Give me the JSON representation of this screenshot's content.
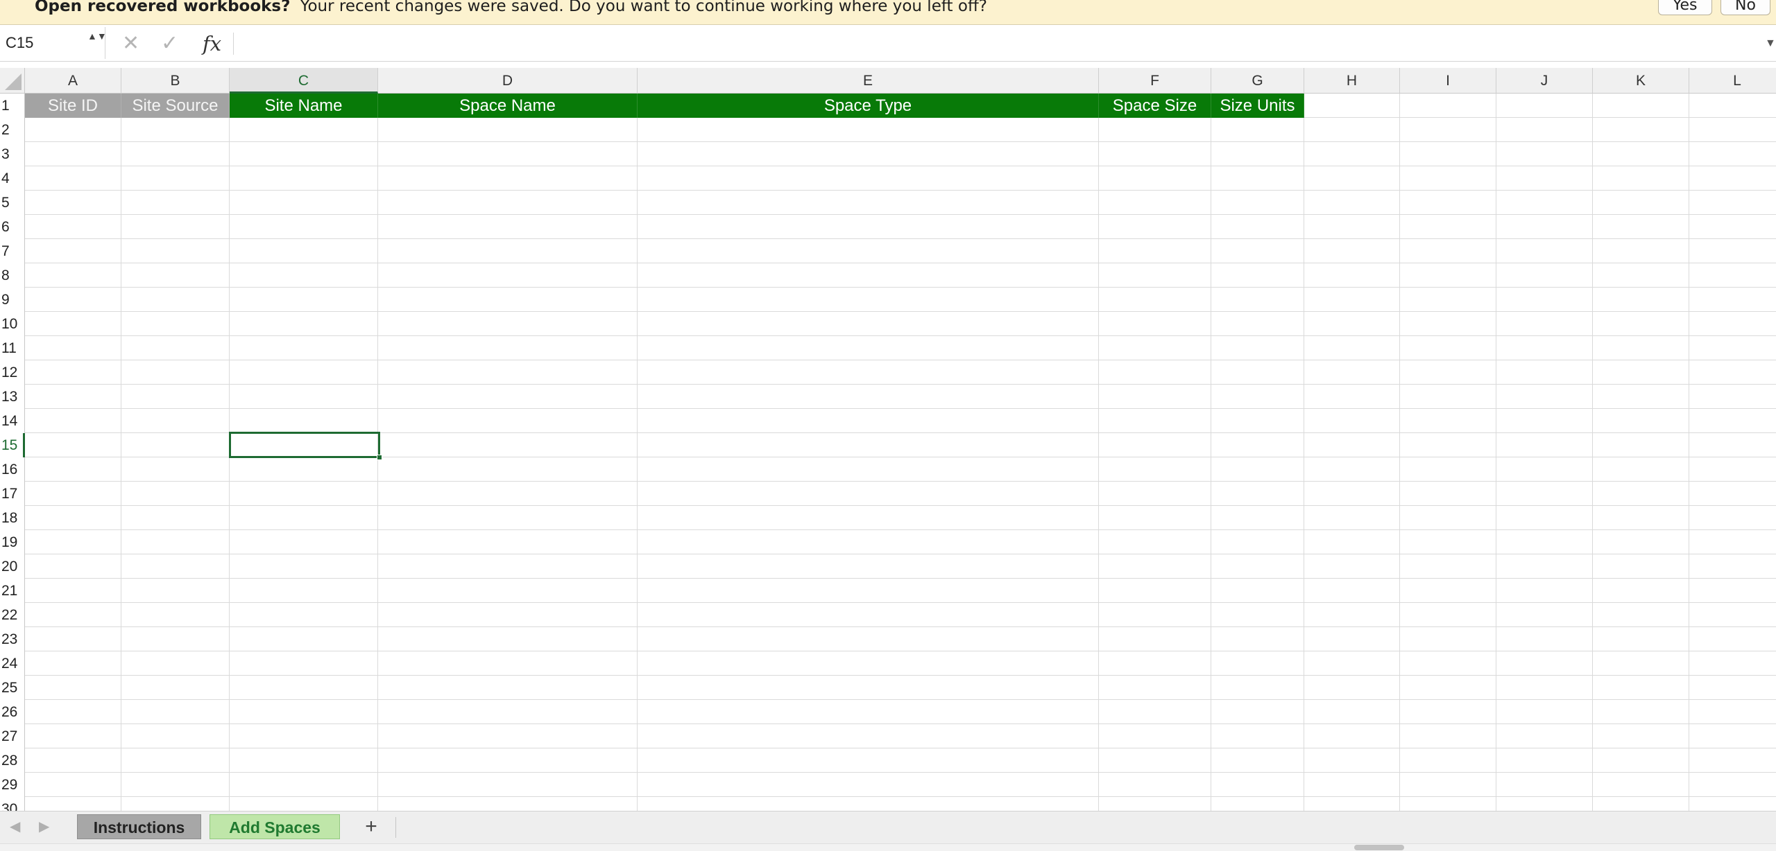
{
  "notification": {
    "title": "Open recovered workbooks?",
    "message": "Your recent changes were saved. Do you want to continue working where you left off?",
    "yes_label": "Yes",
    "no_label": "No"
  },
  "formula_bar": {
    "name_box": "C15",
    "spinner_icon": "▲▼",
    "cancel_icon": "✕",
    "enter_icon": "✓",
    "fx_label": "fx",
    "formula_value": "",
    "expand_icon": "▼"
  },
  "grid": {
    "columns": [
      "A",
      "B",
      "C",
      "D",
      "E",
      "F",
      "G",
      "H",
      "I",
      "J",
      "K",
      "L"
    ],
    "active_column": "C",
    "rows": [
      "1",
      "2",
      "3",
      "4",
      "5",
      "6",
      "7",
      "8",
      "9",
      "10",
      "11",
      "12",
      "13",
      "14",
      "15",
      "16",
      "17",
      "18",
      "19",
      "20",
      "21",
      "22",
      "23",
      "24",
      "25",
      "26",
      "27",
      "28",
      "29",
      "30"
    ],
    "active_row": "15",
    "header_row": [
      "Site ID",
      "Site Source",
      "Site Name",
      "Space Name",
      "Space Type",
      "Space Size",
      "Size Units"
    ],
    "header_colors": {
      "grey": "#a3a3a3",
      "green": "#087a08"
    },
    "selected_cell": "C15",
    "cursor_icon": "crosshair-plus"
  },
  "sheet_tabs": {
    "tabs": [
      "Instructions",
      "Add Spaces"
    ],
    "active_tab": "Add Spaces",
    "prev_icon": "◀",
    "next_icon": "▶",
    "add_icon": "+"
  }
}
